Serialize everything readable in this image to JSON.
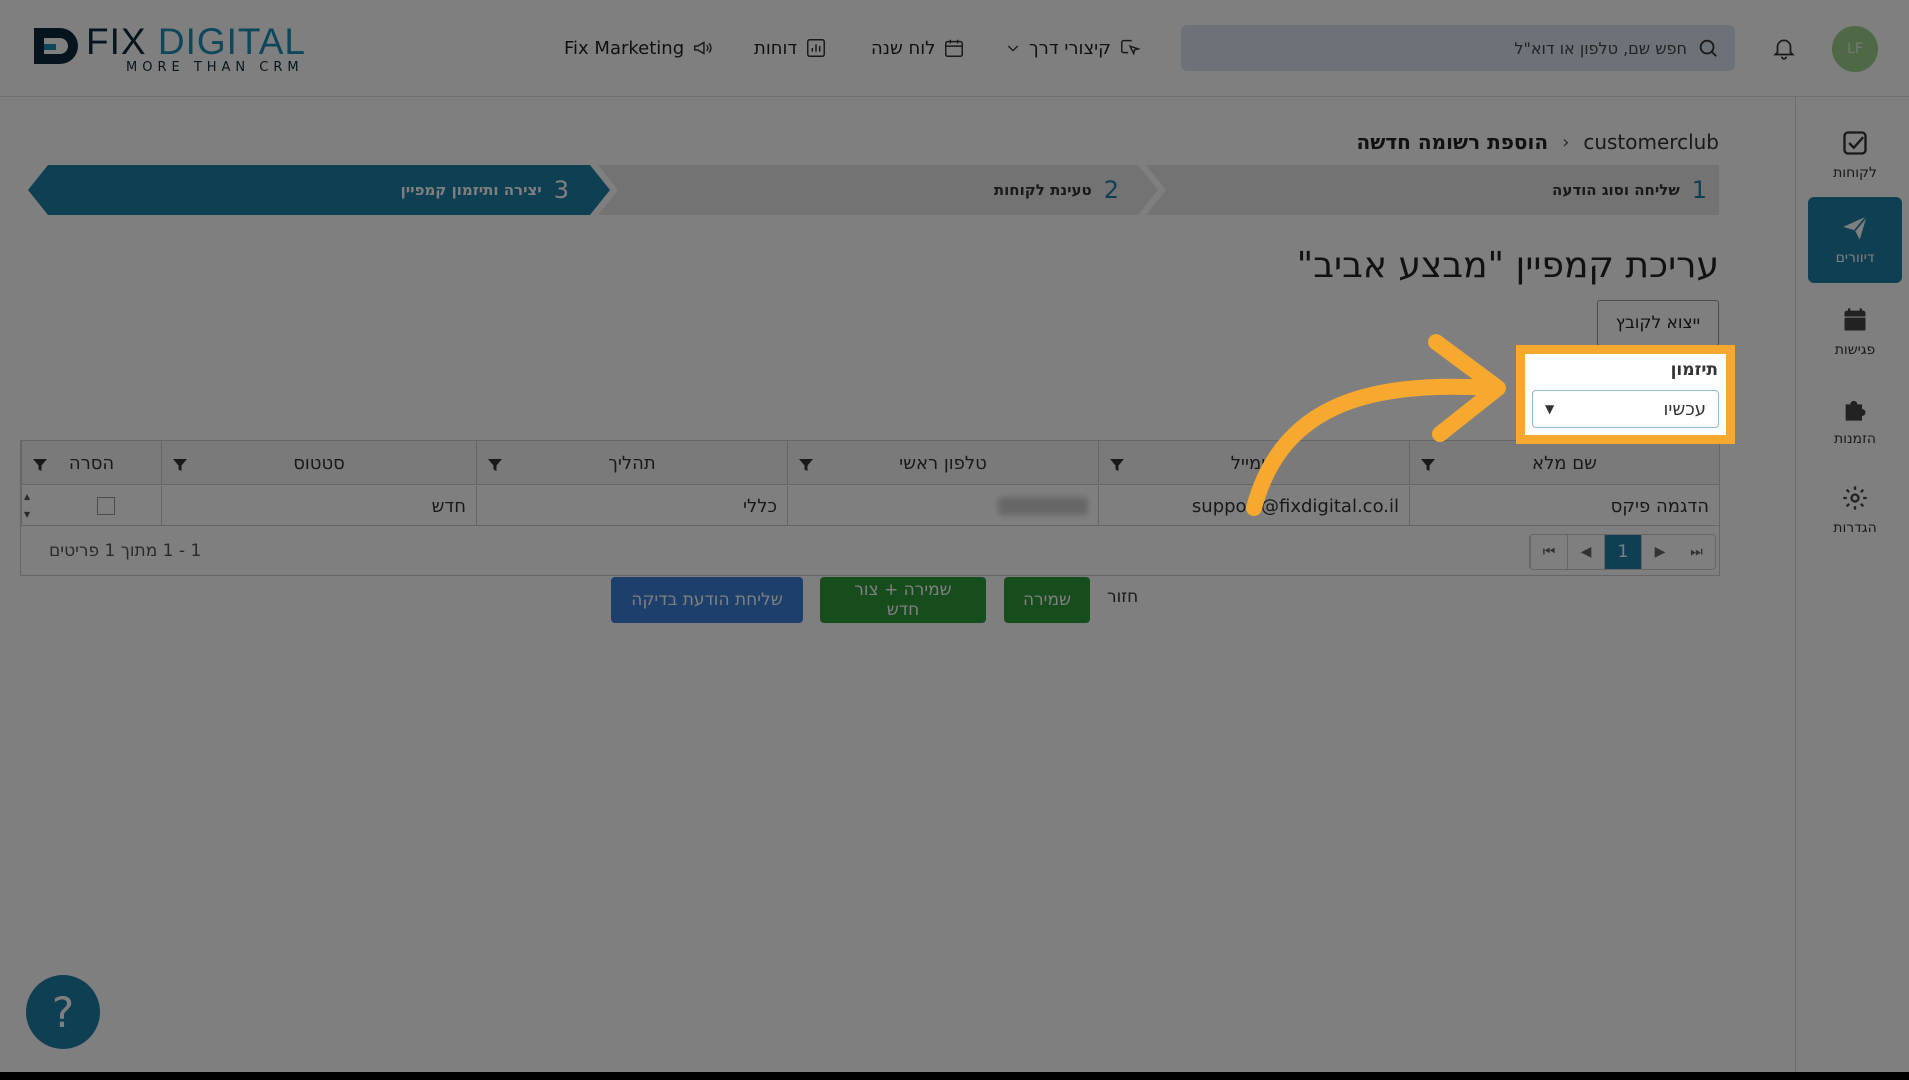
{
  "brand": {
    "name_a": "FIX ",
    "name_b": "DIGITAL",
    "tagline": "MORE THAN CRM"
  },
  "header": {
    "nav": [
      {
        "label": "Fix Marketing",
        "icon": "megaphone-icon"
      },
      {
        "label": "דוחות",
        "icon": "chart-icon"
      },
      {
        "label": "לוח שנה",
        "icon": "calendar-icon"
      },
      {
        "label": "קיצורי דרך",
        "icon": "shortcut-icon"
      }
    ],
    "search_placeholder": "חפש שם, טלפון או דוא\"ל",
    "avatar_initials": "LF"
  },
  "sidebar": {
    "items": [
      {
        "label": "לקוחות",
        "icon": "check-square-icon"
      },
      {
        "label": "דיוורים",
        "icon": "paper-plane-icon",
        "active": true
      },
      {
        "label": "פגישות",
        "icon": "calendar-icon"
      },
      {
        "label": "הזמנות",
        "icon": "puzzle-icon"
      },
      {
        "label": "הגדרות",
        "icon": "gear-icon"
      }
    ]
  },
  "breadcrumb": {
    "root": "customerclub",
    "current": "הוספת רשומה חדשה"
  },
  "steps": [
    {
      "num": "1",
      "label": "שליחה וסוג הודעה"
    },
    {
      "num": "2",
      "label": "טעינת לקוחות"
    },
    {
      "num": "3",
      "label": "יצירה ותיזמון קמפיין",
      "active": true
    }
  ],
  "page": {
    "title": "עריכת קמפיין \"מבצע אביב\"",
    "export_label": "ייצוא לקובץ",
    "schedule_label": "תיזמון",
    "schedule_value": "עכשיו"
  },
  "table": {
    "columns": [
      "שם מלא",
      "אימייל",
      "טלפון ראשי",
      "תהליך",
      "סטטוס",
      "הסרה"
    ],
    "rows": [
      {
        "name": "הדגמה פיקס",
        "email": "support@fixdigital.co.il",
        "process": "כללי",
        "status": "חדש"
      }
    ],
    "current_page": "1",
    "info": "1 - 1 מתוך 1 פריטים"
  },
  "actions": {
    "back": "חזור",
    "save": "שמירה",
    "save_new": "שמירה + צור חדש",
    "send_test": "שליחת הודעת בדיקה"
  },
  "help_label": "?",
  "colors": {
    "primary": "#1f7fa6",
    "green": "#2e9a3a",
    "blue": "#3b7fd9",
    "highlight": "#f7a92f"
  }
}
